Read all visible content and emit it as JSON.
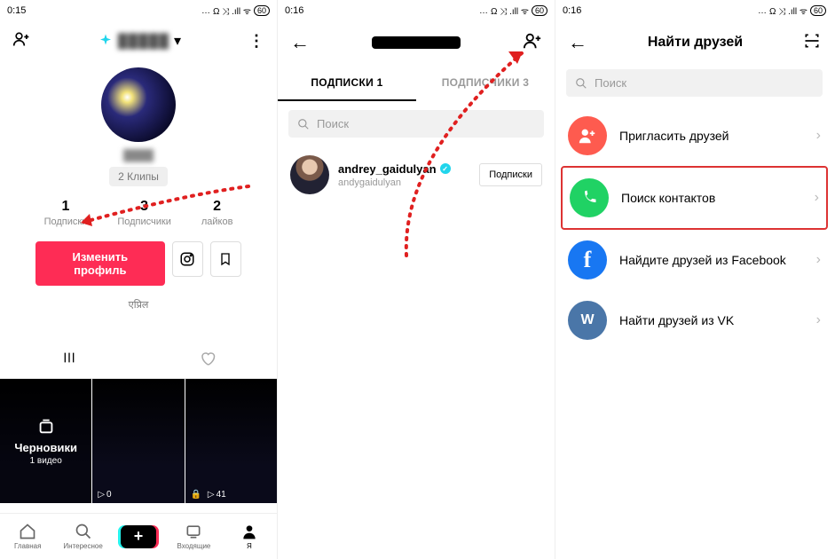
{
  "status": {
    "time1": "0:15",
    "time2": "0:16",
    "battery": "60",
    "indicators": "Ω ⤨ .ıll ᯤ"
  },
  "pane1": {
    "username_blur": "█████",
    "handle_blur": "████",
    "clips": "2 Клипы",
    "stats": [
      {
        "n": "1",
        "l": "Подписки"
      },
      {
        "n": "3",
        "l": "Подписчики"
      },
      {
        "n": "2",
        "l": "лайков"
      }
    ],
    "edit": "Изменить профиль",
    "bio": "एप्रिल",
    "drafts_title": "Черновики",
    "drafts_sub": "1 видео",
    "thumb2_plays": "0",
    "thumb3_plays": "41",
    "nav": [
      "Главная",
      "Интересное",
      "",
      "Входящие",
      "Я"
    ]
  },
  "pane2": {
    "tabs": {
      "following": "ПОДПИСКИ 1",
      "followers": "ПОДПИСЧИКИ 3"
    },
    "search_placeholder": "Поиск",
    "user": {
      "name": "andrey_gaidulyan",
      "handle": "andygaidulyan"
    },
    "follow_label": "Подписки"
  },
  "pane3": {
    "title": "Найти друзей",
    "search_placeholder": "Поиск",
    "options": [
      {
        "label": "Пригласить друзей"
      },
      {
        "label": "Поиск контактов"
      },
      {
        "label": "Найдите друзей из Facebook"
      },
      {
        "label": "Найти друзей из VK"
      }
    ]
  }
}
